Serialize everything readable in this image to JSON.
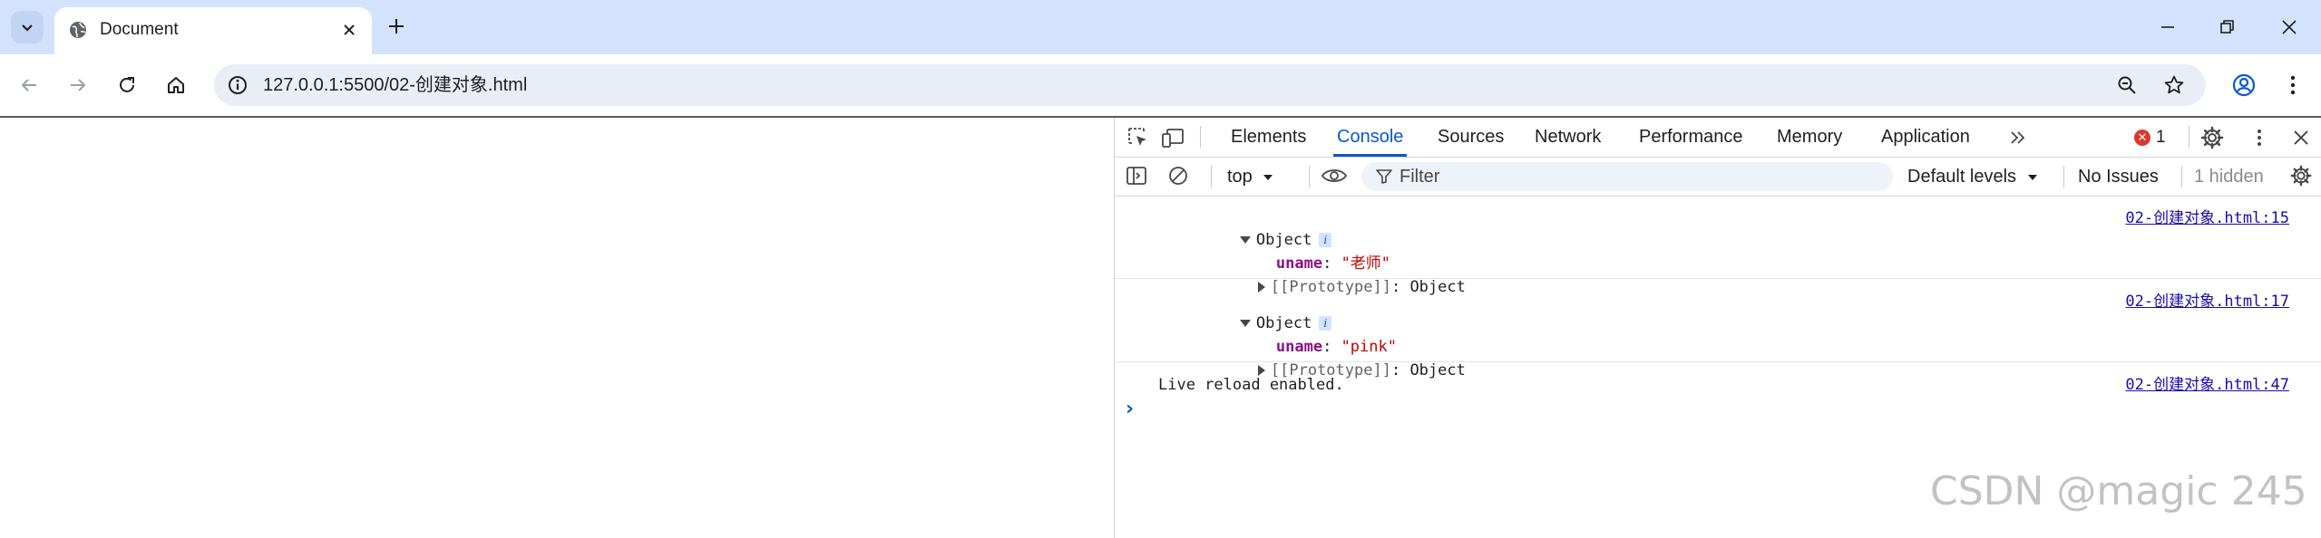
{
  "browser": {
    "tab_title": "Document",
    "url": "127.0.0.1:5500/02-创建对象.html"
  },
  "devtools": {
    "tabs": [
      {
        "label": "Elements",
        "active": false
      },
      {
        "label": "Console",
        "active": true
      },
      {
        "label": "Sources",
        "active": false
      },
      {
        "label": "Network",
        "active": false
      },
      {
        "label": "Performance",
        "active": false
      },
      {
        "label": "Memory",
        "active": false
      },
      {
        "label": "Application",
        "active": false
      }
    ],
    "error_count": "1",
    "error_color": "#dc362e",
    "accent_color": "#0b57d0",
    "context": "top",
    "filter_placeholder": "Filter",
    "levels": "Default levels",
    "issues": "No Issues",
    "hidden": "1 hidden"
  },
  "console": {
    "messages": [
      {
        "label": "Object",
        "info": "i",
        "prop_key": "uname",
        "prop_value": "\"老师\"",
        "proto_key": "[[Prototype]]",
        "proto_value": "Object",
        "source": "02-创建对象.html:15"
      },
      {
        "label": "Object",
        "info": "i",
        "prop_key": "uname",
        "prop_value": "\"pink\"",
        "proto_key": "[[Prototype]]",
        "proto_value": "Object",
        "source": "02-创建对象.html:17"
      },
      {
        "text": "Live reload enabled.",
        "source": "02-创建对象.html:47"
      }
    ]
  },
  "watermark": "CSDN @magic 245"
}
